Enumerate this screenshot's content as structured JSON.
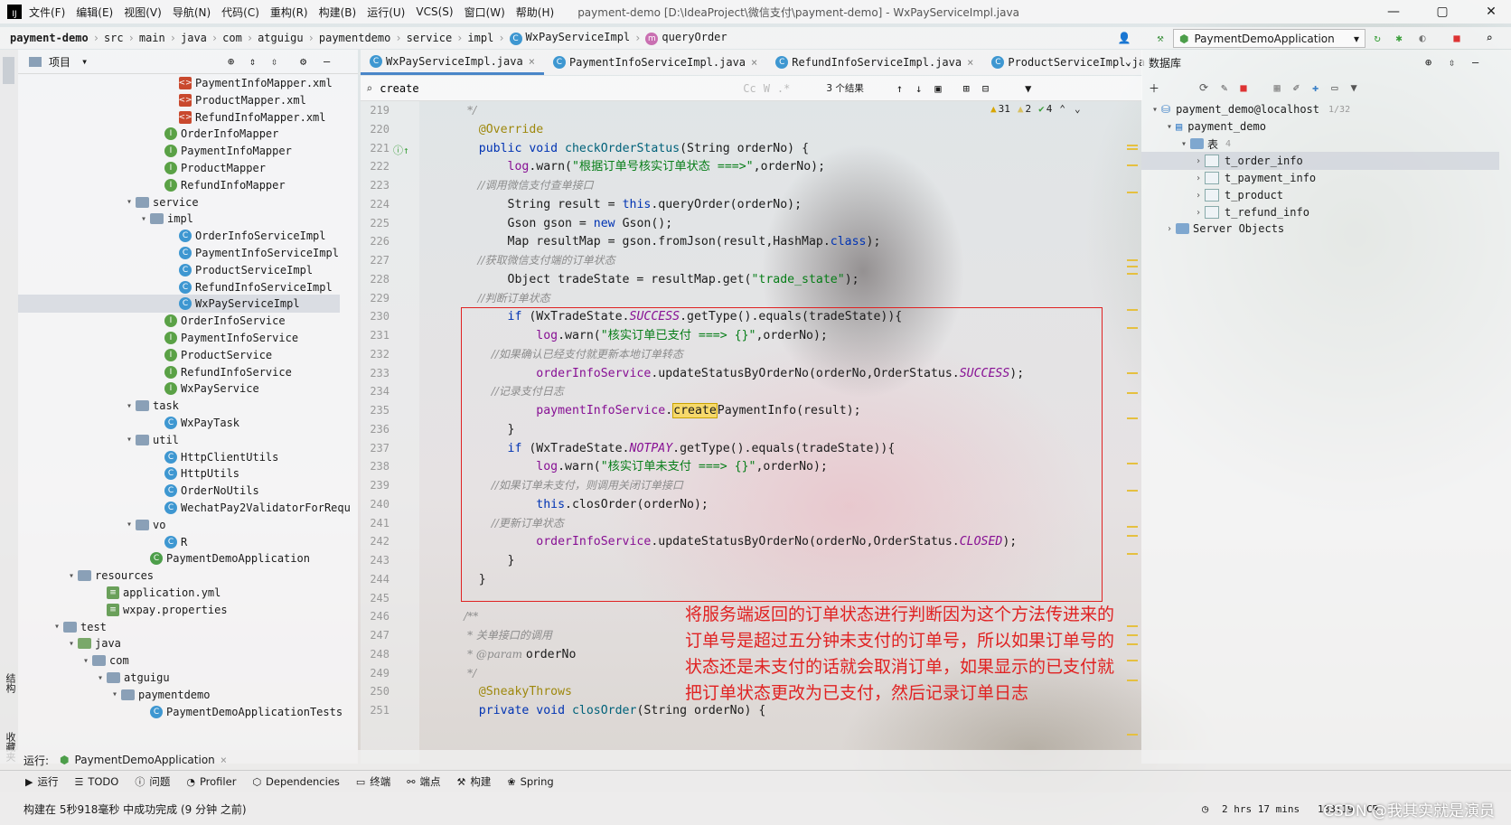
{
  "menu": {
    "logo": "IJ",
    "items": [
      "文件(F)",
      "编辑(E)",
      "视图(V)",
      "导航(N)",
      "代码(C)",
      "重构(R)",
      "构建(B)",
      "运行(U)",
      "VCS(S)",
      "窗口(W)",
      "帮助(H)"
    ],
    "window_title": "payment-demo [D:\\IdeaProject\\微信支付\\payment-demo] - WxPayServiceImpl.java"
  },
  "breadcrumb": [
    "payment-demo",
    "src",
    "main",
    "java",
    "com",
    "atguigu",
    "paymentdemo",
    "service",
    "impl",
    "WxPayServiceImpl",
    "queryOrder"
  ],
  "run_config": "PaymentDemoApplication",
  "project_panel": {
    "title": "项目",
    "items": [
      {
        "label": "PaymentInfoMapper.xml",
        "icon": "xml",
        "depth": 10
      },
      {
        "label": "ProductMapper.xml",
        "icon": "xml",
        "depth": 10
      },
      {
        "label": "RefundInfoMapper.xml",
        "icon": "xml",
        "depth": 10
      },
      {
        "label": "OrderInfoMapper",
        "icon": "interface",
        "depth": 9
      },
      {
        "label": "PaymentInfoMapper",
        "icon": "interface",
        "depth": 9
      },
      {
        "label": "ProductMapper",
        "icon": "interface",
        "depth": 9
      },
      {
        "label": "RefundInfoMapper",
        "icon": "interface",
        "depth": 9
      },
      {
        "label": "service",
        "icon": "folder",
        "depth": 7,
        "arrow": "▾"
      },
      {
        "label": "impl",
        "icon": "folder",
        "depth": 8,
        "arrow": "▾"
      },
      {
        "label": "OrderInfoServiceImpl",
        "icon": "class",
        "depth": 10
      },
      {
        "label": "PaymentInfoServiceImpl",
        "icon": "class",
        "depth": 10
      },
      {
        "label": "ProductServiceImpl",
        "icon": "class",
        "depth": 10
      },
      {
        "label": "RefundInfoServiceImpl",
        "icon": "class",
        "depth": 10
      },
      {
        "label": "WxPayServiceImpl",
        "icon": "class",
        "depth": 10,
        "selected": true
      },
      {
        "label": "OrderInfoService",
        "icon": "interface",
        "depth": 9
      },
      {
        "label": "PaymentInfoService",
        "icon": "interface",
        "depth": 9
      },
      {
        "label": "ProductService",
        "icon": "interface",
        "depth": 9
      },
      {
        "label": "RefundInfoService",
        "icon": "interface",
        "depth": 9
      },
      {
        "label": "WxPayService",
        "icon": "interface",
        "depth": 9
      },
      {
        "label": "task",
        "icon": "folder",
        "depth": 7,
        "arrow": "▾"
      },
      {
        "label": "WxPayTask",
        "icon": "class",
        "depth": 9
      },
      {
        "label": "util",
        "icon": "folder",
        "depth": 7,
        "arrow": "▾"
      },
      {
        "label": "HttpClientUtils",
        "icon": "class",
        "depth": 9
      },
      {
        "label": "HttpUtils",
        "icon": "class",
        "depth": 9
      },
      {
        "label": "OrderNoUtils",
        "icon": "class",
        "depth": 9
      },
      {
        "label": "WechatPay2ValidatorForRequ",
        "icon": "class",
        "depth": 9
      },
      {
        "label": "vo",
        "icon": "folder",
        "depth": 7,
        "arrow": "▾"
      },
      {
        "label": "R",
        "icon": "class",
        "depth": 9
      },
      {
        "label": "PaymentDemoApplication",
        "icon": "app",
        "depth": 8
      },
      {
        "label": "resources",
        "icon": "folder",
        "depth": 3,
        "arrow": "▾"
      },
      {
        "label": "application.yml",
        "icon": "yml",
        "depth": 5
      },
      {
        "label": "wxpay.properties",
        "icon": "yml",
        "depth": 5
      },
      {
        "label": "test",
        "icon": "folder",
        "depth": 2,
        "arrow": "▾"
      },
      {
        "label": "java",
        "icon": "folder-green",
        "depth": 3,
        "arrow": "▾"
      },
      {
        "label": "com",
        "icon": "folder",
        "depth": 4,
        "arrow": "▾"
      },
      {
        "label": "atguigu",
        "icon": "folder",
        "depth": 5,
        "arrow": "▾"
      },
      {
        "label": "paymentdemo",
        "icon": "folder",
        "depth": 6,
        "arrow": "▾"
      },
      {
        "label": "PaymentDemoApplicationTests",
        "icon": "class",
        "depth": 8
      }
    ]
  },
  "editor": {
    "tabs": [
      {
        "label": "WxPayServiceImpl.java",
        "active": true
      },
      {
        "label": "PaymentInfoServiceImpl.java",
        "active": false
      },
      {
        "label": "RefundInfoServiceImpl.java",
        "active": false
      },
      {
        "label": "ProductServiceImpl.ja",
        "active": false
      }
    ],
    "search": {
      "value": "create",
      "results": "3 个结果"
    },
    "inspections": {
      "warnings": "31",
      "weak": "2",
      "ok": "4"
    },
    "lines": [
      {
        "n": "219",
        "t": [
          [
            "cm",
            "     */"
          ]
        ]
      },
      {
        "n": "220",
        "t": [
          [
            "an",
            "    @Override"
          ]
        ]
      },
      {
        "n": "221",
        "t": [
          [
            "kw",
            "    public void "
          ],
          [
            "fn",
            "checkOrderStatus"
          ],
          [
            "",
            "(String orderNo) {"
          ]
        ]
      },
      {
        "n": "222",
        "t": [
          [
            "fld",
            "        log"
          ],
          [
            "",
            ".warn("
          ],
          [
            "st",
            "\"根据订单号核实订单状态 ===>\""
          ],
          [
            "",
            ",orderNo);"
          ]
        ]
      },
      {
        "n": "223",
        "t": [
          [
            "cm",
            "        //调用微信支付查单接口"
          ]
        ]
      },
      {
        "n": "224",
        "t": [
          [
            "",
            "        String result = "
          ],
          [
            "kw",
            "this"
          ],
          [
            "",
            ".queryOrder(orderNo);"
          ]
        ]
      },
      {
        "n": "225",
        "t": [
          [
            "",
            "        Gson gson = "
          ],
          [
            "kw",
            "new "
          ],
          [
            "",
            "Gson();"
          ]
        ]
      },
      {
        "n": "226",
        "t": [
          [
            "",
            "        Map resultMap = gson.fromJson(result,HashMap."
          ],
          [
            "kw",
            "class"
          ],
          [
            "",
            ");"
          ]
        ]
      },
      {
        "n": "227",
        "t": [
          [
            "cm",
            "        //获取微信支付端的订单状态"
          ]
        ]
      },
      {
        "n": "228",
        "t": [
          [
            "",
            "        Object tradeState = resultMap.get("
          ],
          [
            "st",
            "\"trade_state\""
          ],
          [
            "",
            ");"
          ]
        ]
      },
      {
        "n": "229",
        "t": [
          [
            "cm",
            "        //判断订单状态"
          ]
        ]
      },
      {
        "n": "230",
        "t": [
          [
            "kw",
            "        if "
          ],
          [
            "",
            "(WxTradeState."
          ],
          [
            "cst",
            "SUCCESS"
          ],
          [
            "",
            ".getType().equals(tradeState)){"
          ]
        ]
      },
      {
        "n": "231",
        "t": [
          [
            "fld",
            "            log"
          ],
          [
            "",
            ".warn("
          ],
          [
            "st",
            "\"核实订单已支付 ===> {}\""
          ],
          [
            "",
            ",orderNo);"
          ]
        ]
      },
      {
        "n": "232",
        "t": [
          [
            "cm",
            "            //如果确认已经支付就更新本地订单转态"
          ]
        ]
      },
      {
        "n": "233",
        "t": [
          [
            "fld",
            "            orderInfoService"
          ],
          [
            "",
            ".updateStatusByOrderNo(orderNo,OrderStatus."
          ],
          [
            "cst",
            "SUCCESS"
          ],
          [
            "",
            ");"
          ]
        ]
      },
      {
        "n": "234",
        "t": [
          [
            "cm",
            "            //记录支付日志"
          ]
        ]
      },
      {
        "n": "235",
        "t": [
          [
            "fld",
            "            paymentInfoService"
          ],
          [
            "",
            "."
          ],
          [
            "hl",
            "create"
          ],
          [
            "",
            "PaymentInfo(result);"
          ]
        ]
      },
      {
        "n": "236",
        "t": [
          [
            "",
            "        }"
          ]
        ]
      },
      {
        "n": "237",
        "t": [
          [
            "kw",
            "        if "
          ],
          [
            "",
            "(WxTradeState."
          ],
          [
            "cst",
            "NOTPAY"
          ],
          [
            "",
            ".getType().equals(tradeState)){"
          ]
        ]
      },
      {
        "n": "238",
        "t": [
          [
            "fld",
            "            log"
          ],
          [
            "",
            ".warn("
          ],
          [
            "st",
            "\"核实订单未支付 ===> {}\""
          ],
          [
            "",
            ",orderNo);"
          ]
        ]
      },
      {
        "n": "239",
        "t": [
          [
            "cm",
            "            //如果订单未支付，则调用关闭订单接口"
          ]
        ]
      },
      {
        "n": "240",
        "t": [
          [
            "kw",
            "            this"
          ],
          [
            "",
            ".closOrder(orderNo);"
          ]
        ]
      },
      {
        "n": "241",
        "t": [
          [
            "cm",
            "            //更新订单状态"
          ]
        ]
      },
      {
        "n": "242",
        "t": [
          [
            "fld",
            "            orderInfoService"
          ],
          [
            "",
            ".updateStatusByOrderNo(orderNo,OrderStatus."
          ],
          [
            "cst",
            "CLOSED"
          ],
          [
            "",
            ");"
          ]
        ]
      },
      {
        "n": "243",
        "t": [
          [
            "",
            "        }"
          ]
        ]
      },
      {
        "n": "244",
        "t": [
          [
            "",
            "    }"
          ]
        ]
      },
      {
        "n": "245",
        "t": [
          [
            "",
            ""
          ]
        ]
      },
      {
        "n": "246",
        "t": [
          [
            "cm",
            "    /**"
          ]
        ]
      },
      {
        "n": "247",
        "t": [
          [
            "cm",
            "     * 关单接口的调用"
          ]
        ]
      },
      {
        "n": "248",
        "t": [
          [
            "cm",
            "     * "
          ],
          [
            "cm",
            "@param "
          ],
          [
            "",
            "orderNo"
          ]
        ]
      },
      {
        "n": "249",
        "t": [
          [
            "cm",
            "     */"
          ]
        ]
      },
      {
        "n": "250",
        "t": [
          [
            "an",
            "    @SneakyThrows"
          ]
        ]
      },
      {
        "n": "251",
        "t": [
          [
            "kw",
            "    private void "
          ],
          [
            "fn",
            "closOrder"
          ],
          [
            "",
            "(String orderNo) {"
          ]
        ]
      }
    ]
  },
  "annotation": [
    "将服务端返回的订单状态进行判断因为这个方法传进来的",
    "订单号是超过五分钟未支付的订单号，所以如果订单号的",
    "状态还是未支付的话就会取消订单，如果显示的已支付就",
    "把订单状态更改为已支付，然后记录订单日志"
  ],
  "database_panel": {
    "title": "数据库",
    "connection": "payment_demo@localhost",
    "connection_count": "1/32",
    "schema": "payment_demo",
    "tables_label": "表",
    "tables_count": "4",
    "tables": [
      "t_order_info",
      "t_payment_info",
      "t_product",
      "t_refund_info"
    ],
    "server_objects": "Server Objects"
  },
  "run_bar": {
    "label": "运行:",
    "config": "PaymentDemoApplication"
  },
  "tool_windows": [
    "运行",
    "TODO",
    "问题",
    "Profiler",
    "Dependencies",
    "终端",
    "端点",
    "构建",
    "Spring"
  ],
  "status": {
    "message": "构建在 5秒918毫秒 中成功完成 (9 分钟 之前)",
    "time": "2 hrs 17 mins",
    "position": "183:19",
    "line_sep": "CR"
  },
  "side_labels": {
    "structure": "结构",
    "favorites": "收藏夹"
  },
  "watermark": "CSDN @我其实就是演员",
  "colors": {
    "accent": "#4a86c8",
    "highlight_box": "#e02222",
    "keyword": "#0033b3",
    "string": "#067d17",
    "comment": "#8c8c8c",
    "field": "#871094",
    "annotation": "#9e880d"
  }
}
